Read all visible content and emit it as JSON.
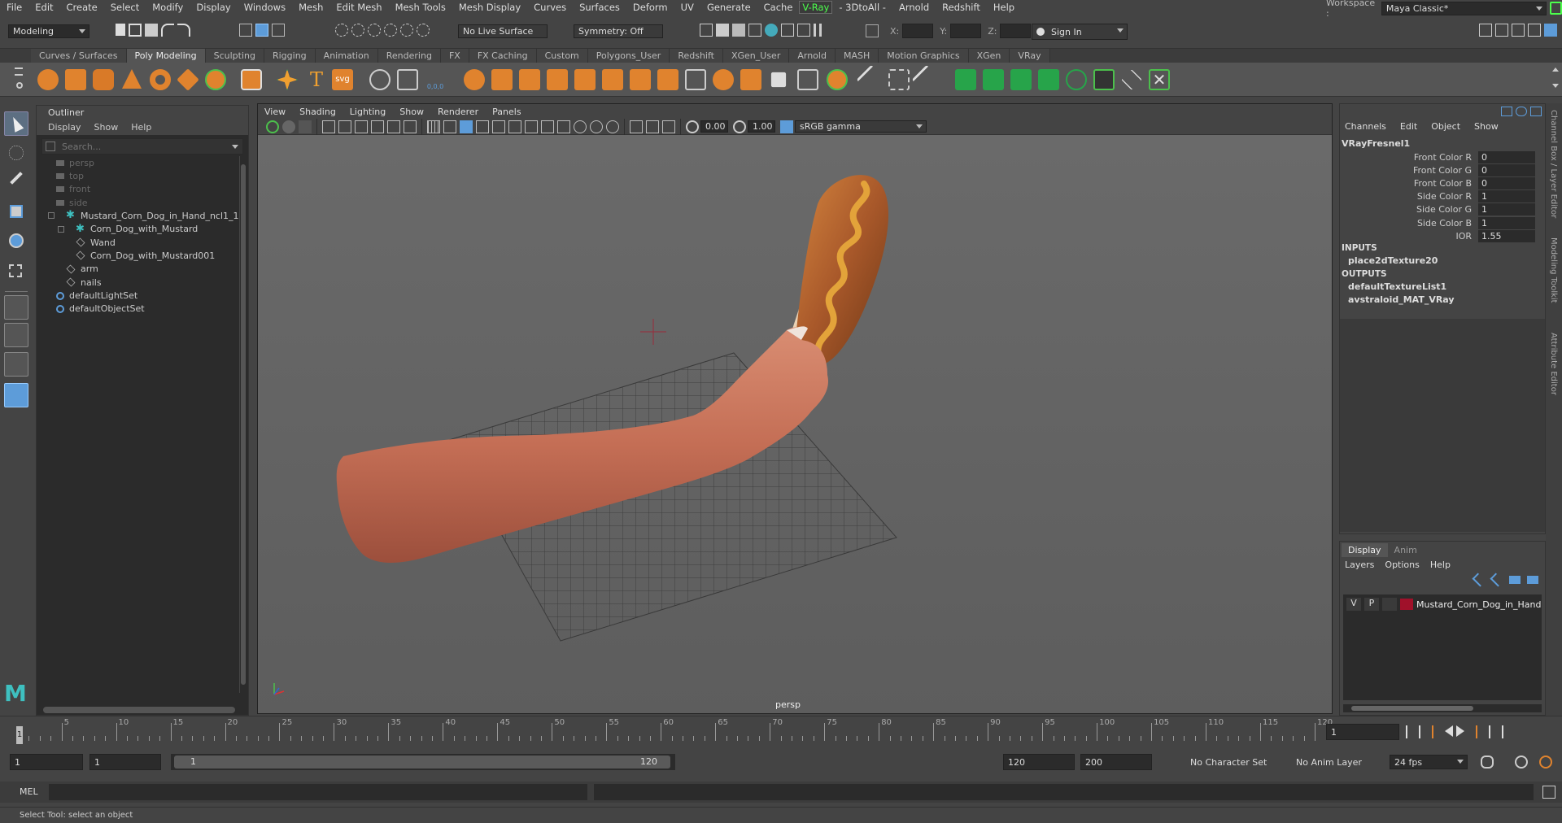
{
  "menubar": {
    "items": [
      "File",
      "Edit",
      "Create",
      "Select",
      "Modify",
      "Display",
      "Windows",
      "Mesh",
      "Edit Mesh",
      "Mesh Tools",
      "Mesh Display",
      "Curves",
      "Surfaces",
      "Deform",
      "UV",
      "Generate",
      "Cache",
      "V-Ray",
      "- 3DtoAll -",
      "Arnold",
      "Redshift",
      "Help"
    ],
    "workspace_label": "Workspace :",
    "workspace_value": "Maya Classic*"
  },
  "statusline": {
    "mode": "Modeling",
    "live_surface": "No Live Surface",
    "symmetry": "Symmetry: Off",
    "x_label": "X:",
    "y_label": "Y:",
    "z_label": "Z:",
    "sign_in": "Sign In"
  },
  "shelf_tabs": [
    "Curves / Surfaces",
    "Poly Modeling",
    "Sculpting",
    "Rigging",
    "Animation",
    "Rendering",
    "FX",
    "FX Caching",
    "Custom",
    "Polygons_User",
    "Redshift",
    "XGen_User",
    "Arnold",
    "MASH",
    "Motion Graphics",
    "XGen",
    "VRay"
  ],
  "shelf_active": "Poly Modeling",
  "shelf_labels": {
    "text_tool": "T",
    "svg_tool": "svg",
    "coords": "0,0,0"
  },
  "outliner": {
    "title": "Outliner",
    "menus": [
      "Display",
      "Show",
      "Help"
    ],
    "search_placeholder": "Search...",
    "items": [
      {
        "label": "persp",
        "type": "camera",
        "level": 0
      },
      {
        "label": "top",
        "type": "camera",
        "level": 0
      },
      {
        "label": "front",
        "type": "camera",
        "level": 0
      },
      {
        "label": "side",
        "type": "camera",
        "level": 0
      },
      {
        "label": "Mustard_Corn_Dog_in_Hand_ncl1_1",
        "type": "group",
        "level": 0
      },
      {
        "label": "Corn_Dog_with_Mustard",
        "type": "group",
        "level": 1
      },
      {
        "label": "Wand",
        "type": "mesh",
        "level": 2
      },
      {
        "label": "Corn_Dog_with_Mustard001",
        "type": "mesh",
        "level": 2
      },
      {
        "label": "arm",
        "type": "mesh",
        "level": 1
      },
      {
        "label": "nails",
        "type": "mesh",
        "level": 1
      },
      {
        "label": "defaultLightSet",
        "type": "set",
        "level": 0
      },
      {
        "label": "defaultObjectSet",
        "type": "set",
        "level": 0
      }
    ]
  },
  "viewport": {
    "menus": [
      "View",
      "Shading",
      "Lighting",
      "Show",
      "Renderer",
      "Panels"
    ],
    "exposure": "0.00",
    "gamma": "1.00",
    "color_space": "sRGB gamma",
    "camera_label": "persp"
  },
  "channelbox": {
    "menus": [
      "Channels",
      "Edit",
      "Object",
      "Show"
    ],
    "node": "VRayFresnel1",
    "attributes": [
      {
        "label": "Front Color R",
        "value": "0"
      },
      {
        "label": "Front Color G",
        "value": "0"
      },
      {
        "label": "Front Color B",
        "value": "0"
      },
      {
        "label": "Side Color R",
        "value": "1"
      },
      {
        "label": "Side Color G",
        "value": "1"
      },
      {
        "label": "Side Color B",
        "value": "1"
      },
      {
        "label": "IOR",
        "value": "1.55"
      }
    ],
    "inputs_label": "INPUTS",
    "inputs": [
      "place2dTexture20"
    ],
    "outputs_label": "OUTPUTS",
    "outputs": [
      "defaultTextureList1",
      "avstraloid_MAT_VRay"
    ]
  },
  "side_tabs": [
    "Channel Box / Layer Editor",
    "Modeling Toolkit",
    "Attribute Editor"
  ],
  "layers": {
    "tabs": [
      "Display",
      "Anim"
    ],
    "active_tab": "Display",
    "menus": [
      "Layers",
      "Options",
      "Help"
    ],
    "layer": {
      "v": "V",
      "p": "P",
      "name": "Mustard_Corn_Dog_in_Hand",
      "color": "#a0112a"
    }
  },
  "timeline": {
    "ticks": [
      "5",
      "10",
      "15",
      "20",
      "25",
      "30",
      "35",
      "40",
      "45",
      "50",
      "55",
      "60",
      "65",
      "70",
      "75",
      "80",
      "85",
      "90",
      "95",
      "100",
      "105",
      "110",
      "115",
      "120"
    ],
    "current_frame_marker": "1",
    "current_frame": "1"
  },
  "range": {
    "start": "1",
    "playback_start": "1",
    "slider_start": "1",
    "slider_end": "120",
    "playback_end": "120",
    "end": "200",
    "character_set": "No Character Set",
    "anim_layer": "No Anim Layer",
    "fps": "24 fps"
  },
  "cmdline": {
    "lang": "MEL"
  },
  "helpline": {
    "text": "Select Tool: select an object"
  },
  "colors": {
    "accent": "#5d9cd9",
    "mustard": "#e3a33a",
    "corndog": "#b5652a",
    "skin": "#c9785e",
    "vray_green": "#4cff4c"
  }
}
